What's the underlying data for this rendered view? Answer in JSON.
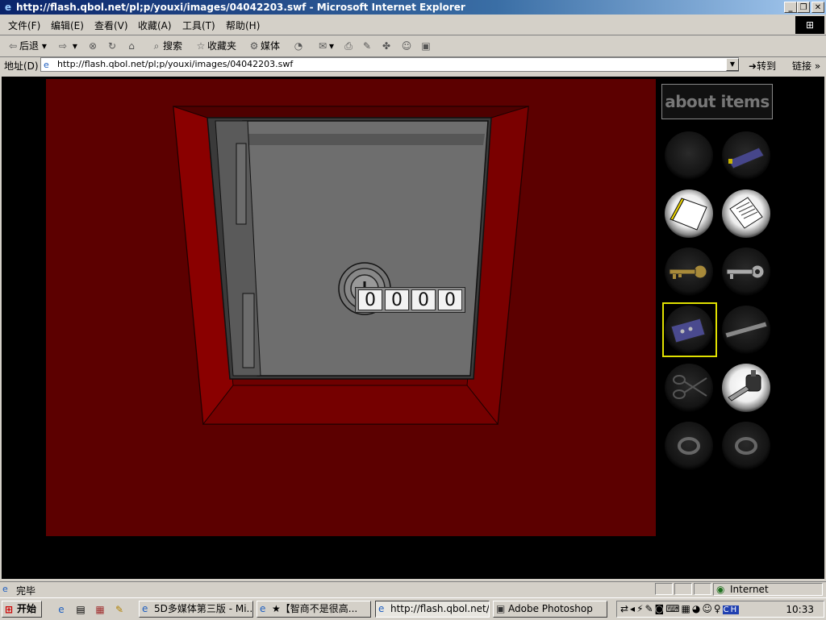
{
  "window": {
    "title": "http://flash.qbol.net/pl;p/youxi/images/04042203.swf - Microsoft Internet Explorer"
  },
  "menu": [
    "文件(F)",
    "编辑(E)",
    "查看(V)",
    "收藏(A)",
    "工具(T)",
    "帮助(H)"
  ],
  "toolbar": {
    "back": "后退",
    "search": "搜索",
    "favorites": "收藏夹",
    "media": "媒体"
  },
  "address": {
    "label": "地址(D)",
    "url": "http://flash.qbol.net/pl;p/youxi/images/04042203.swf",
    "go": "转到",
    "links": "链接"
  },
  "game": {
    "code_digits": [
      "0",
      "0",
      "0",
      "0"
    ],
    "about_label": "about items",
    "items": [
      {
        "name": "empty",
        "icon": "empty-slot"
      },
      {
        "name": "purple-box",
        "icon": "purple-box-icon"
      },
      {
        "name": "yellow-note",
        "icon": "note-icon",
        "lit": true
      },
      {
        "name": "paper-letter",
        "icon": "letter-icon",
        "lit": true
      },
      {
        "name": "gold-key",
        "icon": "gold-key-icon"
      },
      {
        "name": "silver-key",
        "icon": "silver-key-icon"
      },
      {
        "name": "purple-card",
        "icon": "card-icon",
        "selected": true
      },
      {
        "name": "metal-bar",
        "icon": "bar-icon"
      },
      {
        "name": "scissors",
        "icon": "scissors-icon"
      },
      {
        "name": "car-key",
        "icon": "car-key-icon",
        "lit": true
      },
      {
        "name": "ring-1",
        "icon": "ring-icon"
      },
      {
        "name": "ring-2",
        "icon": "ring-icon"
      }
    ]
  },
  "status": {
    "text": "完毕",
    "zone": "Internet"
  },
  "taskbar": {
    "start": "开始",
    "tasks": [
      "5D多媒体第三版 - Mi...",
      "★【智商不是很高...",
      "http://flash.qbol.net/...",
      "Adobe Photoshop"
    ],
    "clock": "10:33"
  }
}
